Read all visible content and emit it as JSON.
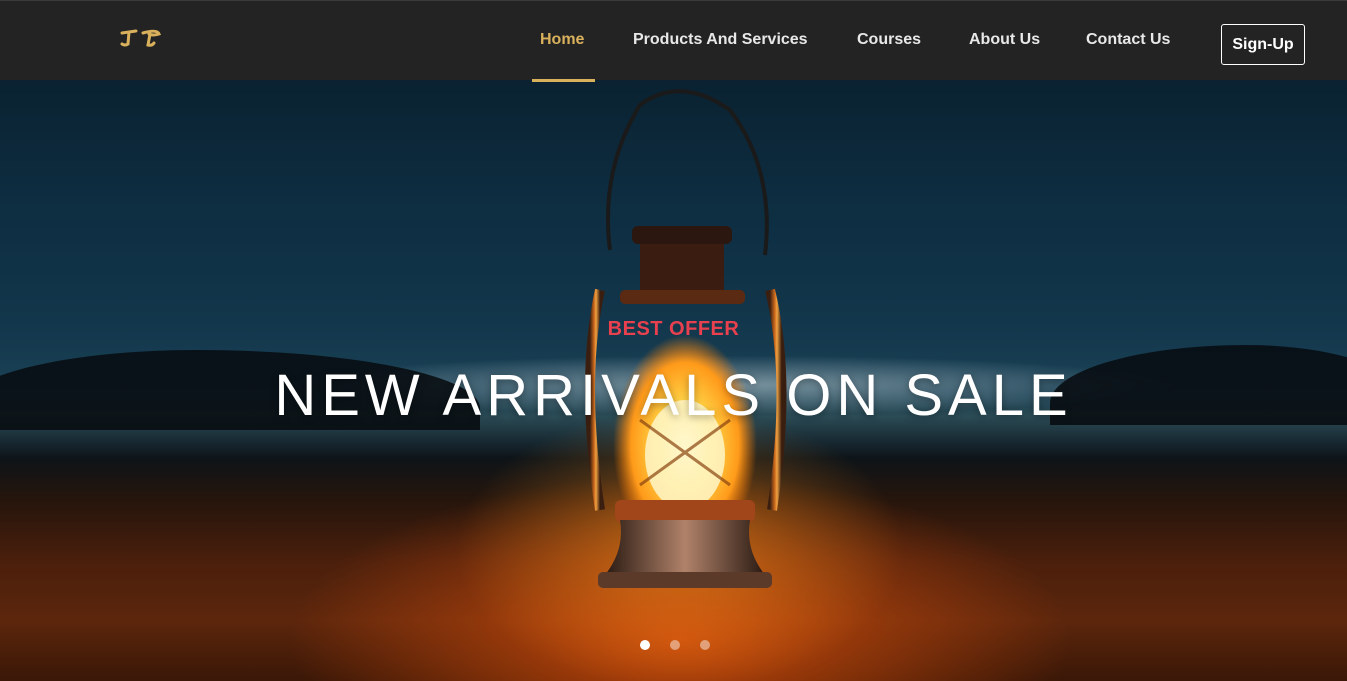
{
  "nav": {
    "logo_icon": "brand-logo-glyph",
    "items": [
      {
        "label": "Home",
        "active": true
      },
      {
        "label": "Products And Services",
        "active": false
      },
      {
        "label": "Courses",
        "active": false
      },
      {
        "label": "About Us",
        "active": false
      },
      {
        "label": "Contact Us",
        "active": false
      }
    ],
    "signup_label": "Sign-Up"
  },
  "hero": {
    "subtitle": "BEST OFFER",
    "headline": "NEW ARRIVALS ON SALE",
    "image_icon": "lantern-illustration",
    "slide_count": 3,
    "active_slide": 1
  },
  "colors": {
    "accent": "#d9b15d",
    "offer": "#e8404e",
    "nav_bg": "#232323"
  }
}
